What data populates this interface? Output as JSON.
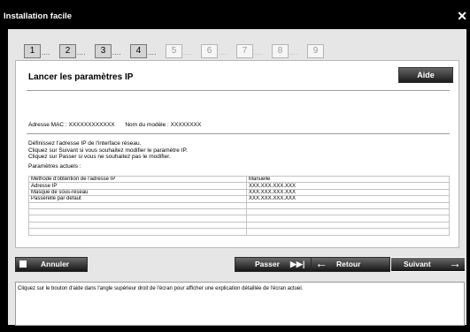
{
  "window": {
    "title": "Installation facile",
    "close_icon": "close-icon"
  },
  "steps": [
    {
      "n": "1",
      "state": "done"
    },
    {
      "n": "2",
      "state": "done"
    },
    {
      "n": "3",
      "state": "done"
    },
    {
      "n": "4",
      "state": "current"
    },
    {
      "n": "5",
      "state": "pending"
    },
    {
      "n": "6",
      "state": "pending"
    },
    {
      "n": "7",
      "state": "pending"
    },
    {
      "n": "8",
      "state": "pending"
    },
    {
      "n": "9",
      "state": "pending"
    }
  ],
  "step_dots": "....",
  "panel": {
    "title": "Lancer les paramètres IP",
    "help": "Aide",
    "mac_label": "Adresse MAC : XXXXXXXXXXXX",
    "model_label": "Nom du modèle : XXXXXXXX",
    "instructions": [
      "Définissez l'adresse IP de l'interface réseau.",
      "Cliquez sur Suivant si vous souhaitez modifier le paramètre IP.",
      "Cliquez sur Passer si vous ne souhaitez pas le modifier."
    ],
    "current_label": "Paramètres actuels :",
    "rows": [
      {
        "name": "Méthode d'obtention de l'adresse IP",
        "value": "Manuelle"
      },
      {
        "name": "Adresse IP",
        "value": "XXX.XXX.XXX.XXX"
      },
      {
        "name": "Masque de sous-réseau",
        "value": "XXX.XXX.XXX.XXX"
      },
      {
        "name": "Passerelle par défaut",
        "value": "XXX.XXX.XXX.XXX"
      },
      {
        "name": "",
        "value": ""
      },
      {
        "name": "",
        "value": ""
      },
      {
        "name": "",
        "value": ""
      },
      {
        "name": "",
        "value": ""
      },
      {
        "name": "",
        "value": ""
      }
    ]
  },
  "buttons": {
    "cancel": "Annuler",
    "skip": "Passer",
    "back": "Retour",
    "next": "Suivant"
  },
  "note": "Cliquez sur le bouton d'aide dans l'angle supérieur droit de l'écran pour afficher une explication détaillée de l'écran actuel."
}
